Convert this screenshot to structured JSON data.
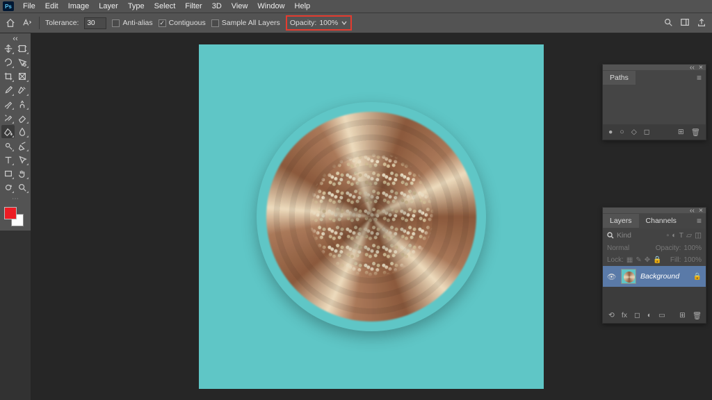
{
  "menubar": [
    "File",
    "Edit",
    "Image",
    "Layer",
    "Type",
    "Select",
    "Filter",
    "3D",
    "View",
    "Window",
    "Help"
  ],
  "optionsbar": {
    "tolerance_label": "Tolerance:",
    "tolerance_value": "30",
    "antialias_label": "Anti-alias",
    "antialias_checked": false,
    "contiguous_label": "Contiguous",
    "contiguous_checked": true,
    "sample_layers_label": "Sample All Layers",
    "sample_layers_checked": false,
    "opacity_label": "Opacity:",
    "opacity_value": "100%"
  },
  "tools": [
    "move",
    "artboard",
    "lasso",
    "quick-select",
    "crop",
    "frame",
    "eyedropper",
    "heal",
    "brush",
    "clone",
    "history-brush",
    "eraser",
    "paint-bucket",
    "blur",
    "dodge",
    "pen",
    "type",
    "path-select",
    "rectangle",
    "hand",
    "rotate-view",
    "zoom"
  ],
  "active_tool_index": 12,
  "swatches": {
    "fg": "#ec1c24",
    "bg": "#ffffff"
  },
  "canvas": {
    "bg": "#5fc6c6"
  },
  "paths_panel": {
    "title": "Paths",
    "footer_icons": [
      "fill",
      "stroke",
      "selection",
      "mask",
      "new",
      "delete"
    ]
  },
  "layers_panel": {
    "tabs": [
      "Layers",
      "Channels"
    ],
    "active_tab": 0,
    "kind_label": "Kind",
    "blend_mode": "Normal",
    "opacity_label": "Opacity:",
    "opacity_value": "100%",
    "lock_label": "Lock:",
    "fill_label": "Fill:",
    "fill_value": "100%",
    "layers": [
      {
        "name": "Background",
        "locked": true,
        "visible": true
      }
    ],
    "footer_icons": [
      "link",
      "fx",
      "mask",
      "adjust",
      "group",
      "new",
      "delete"
    ]
  }
}
